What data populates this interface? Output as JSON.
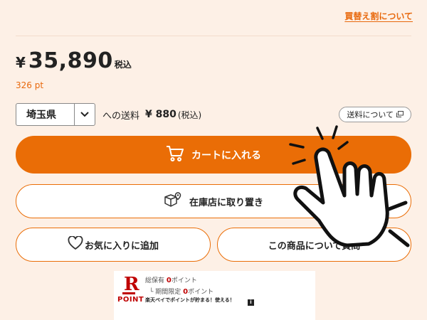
{
  "trade_in_link": "買替え割について",
  "price": {
    "currency": "¥",
    "amount": "35,890",
    "tax_label": "税込"
  },
  "points": "326 pt",
  "shipping": {
    "prefecture": "埼玉県",
    "to_label": "への送料",
    "fee": "¥ 880",
    "fee_tax": "(税込)",
    "info_button": "送料について"
  },
  "buttons": {
    "cart": "カートに入れる",
    "store_pickup": "在庫店に取り置き",
    "favorite": "お気に入りに追加",
    "ask": "この商品について質問"
  },
  "rakuten_point": {
    "logo_letter": "R",
    "logo_word": "POINT",
    "total_label": "総保有",
    "total_value": "0",
    "total_unit": "ポイント",
    "limited_label": "└ 期間限定",
    "limited_value": "0",
    "limited_unit": "ポイント",
    "slogan": "楽天ペイでポイントが貯まる！使える！",
    "info_icon": "i"
  },
  "colors": {
    "accent": "#ea6d06",
    "background": "#fdf0e6",
    "rakuten_red": "#bf0000"
  },
  "icons": [
    "cart-icon",
    "package-location-icon",
    "heart-icon",
    "external-window-icon",
    "chevron-down-icon",
    "tap-hand-icon"
  ]
}
